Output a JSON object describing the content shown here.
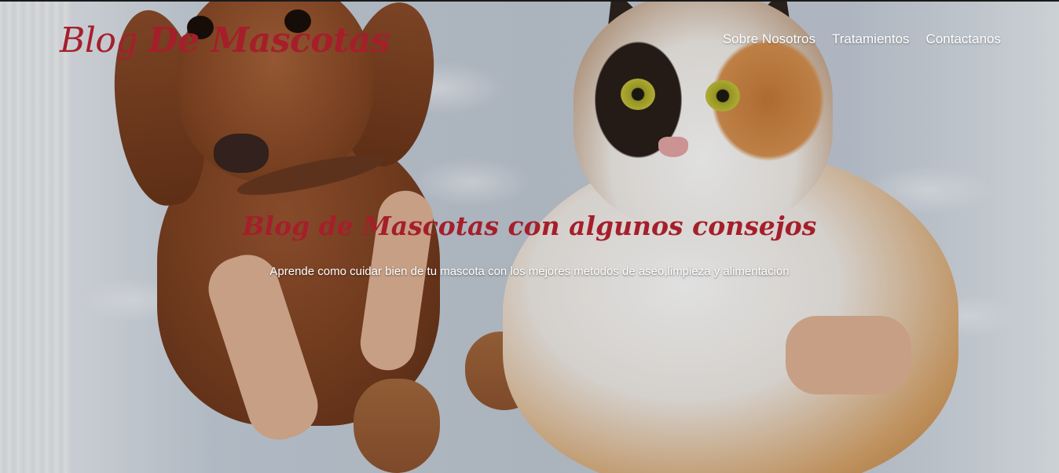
{
  "header": {
    "logo_part1": "Blog ",
    "logo_part2": "De Mascotas",
    "nav": [
      {
        "label": "Sobre Nosotros"
      },
      {
        "label": "Tratamientos"
      },
      {
        "label": "Contactanos"
      }
    ]
  },
  "hero": {
    "title": "Blog de Mascotas con algunos consejos",
    "subtitle": "Aprende como cuidar bien de tu mascota con los mejores metodos de aseo,limpieza y alimentacion",
    "image": "dog-and-cat-photo"
  },
  "colors": {
    "brand_red": "#a51f2b",
    "nav_text": "#ffffff"
  }
}
